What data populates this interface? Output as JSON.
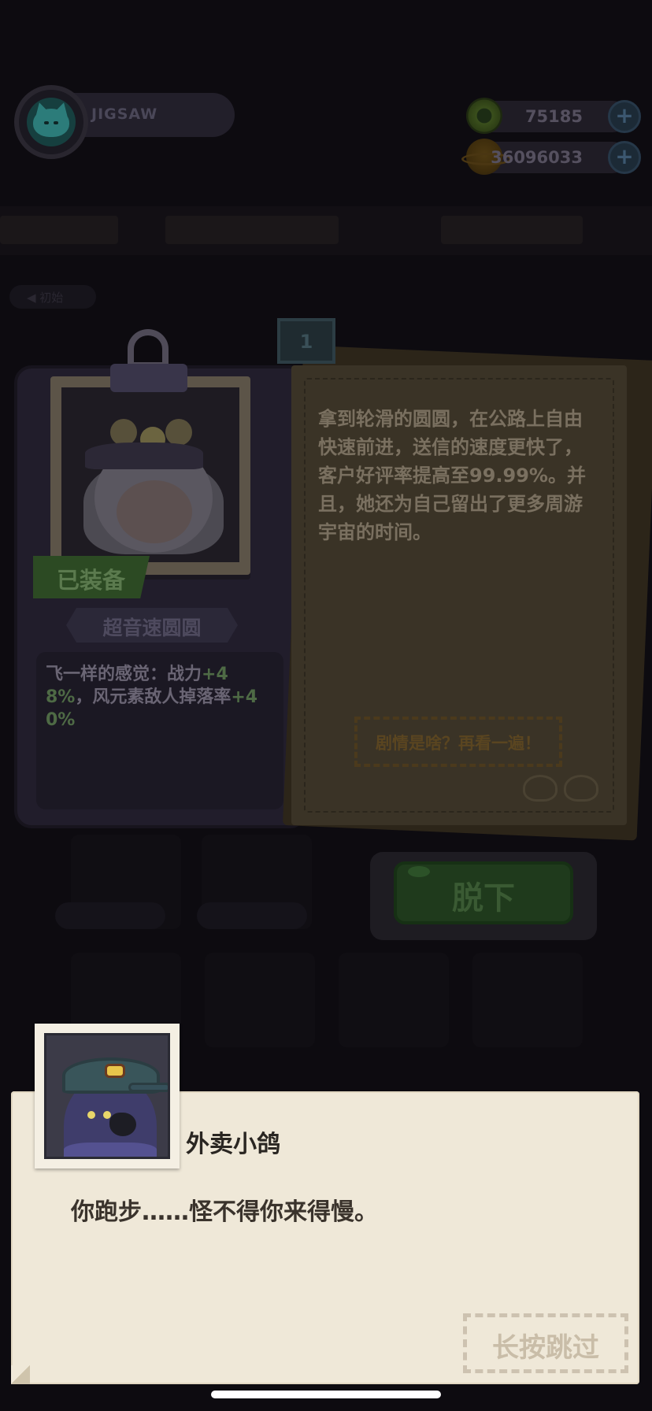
{
  "player": {
    "name": "JIGSAW"
  },
  "resources": [
    {
      "icon": "donut-gem-icon",
      "value": "75185"
    },
    {
      "icon": "planet-coin-icon",
      "value": "36096033"
    }
  ],
  "scene": {
    "tab_label": "◀ 初始"
  },
  "card": {
    "status_tag": "已装备",
    "tab_number": "1",
    "skin_name": "超音速圆圆",
    "effect_prefix": "飞一样的感觉：战力",
    "effect_power_bonus": "+48%",
    "effect_middle": "，风元素敌人掉落率",
    "effect_drop_bonus": "+40%",
    "story": "拿到轮滑的圆圆，在公路上自由快速前进，送信的速度更快了，客户好评率提高至99.99%。并且，她还为自己留出了更多周游宇宙的时间。",
    "replay_label": "剧情是啥？再看一遍！",
    "unequip_label": "脱下"
  },
  "dialog": {
    "speaker": "外卖小鸽",
    "line": "你跑步……怪不得你来得慢。",
    "skip_label": "长按跳过"
  },
  "colors": {
    "dialog_bg": "#efe8d8",
    "overlay_bg": "#0d0b10",
    "equipped_green": "#2c4a23"
  }
}
